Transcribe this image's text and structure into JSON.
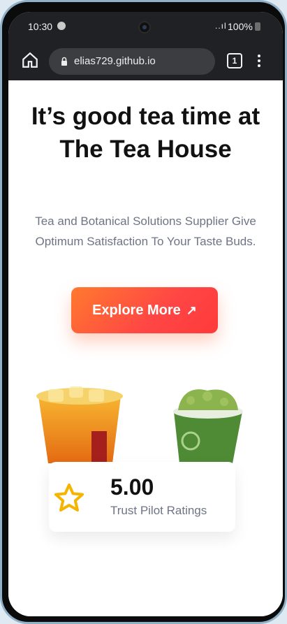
{
  "status_bar": {
    "time": "10:30",
    "battery": "100%",
    "signal": "..ıl"
  },
  "browser": {
    "url": "elias729.github.io",
    "tab_count": "1"
  },
  "hero": {
    "headline": "It’s good tea time at The Tea House",
    "subtext": "Tea and Botanical Solutions Supplier Give Optimum Satisfaction To Your Taste Buds.",
    "cta_label": "Explore More",
    "cta_icon": "↗"
  },
  "rating": {
    "value": "5.00",
    "label": "Trust Pilot Ratings"
  },
  "colors": {
    "accent_start": "#ff7a2e",
    "accent_end": "#ff3a3a",
    "star": "#f4b400",
    "text_muted": "#6e7485"
  }
}
